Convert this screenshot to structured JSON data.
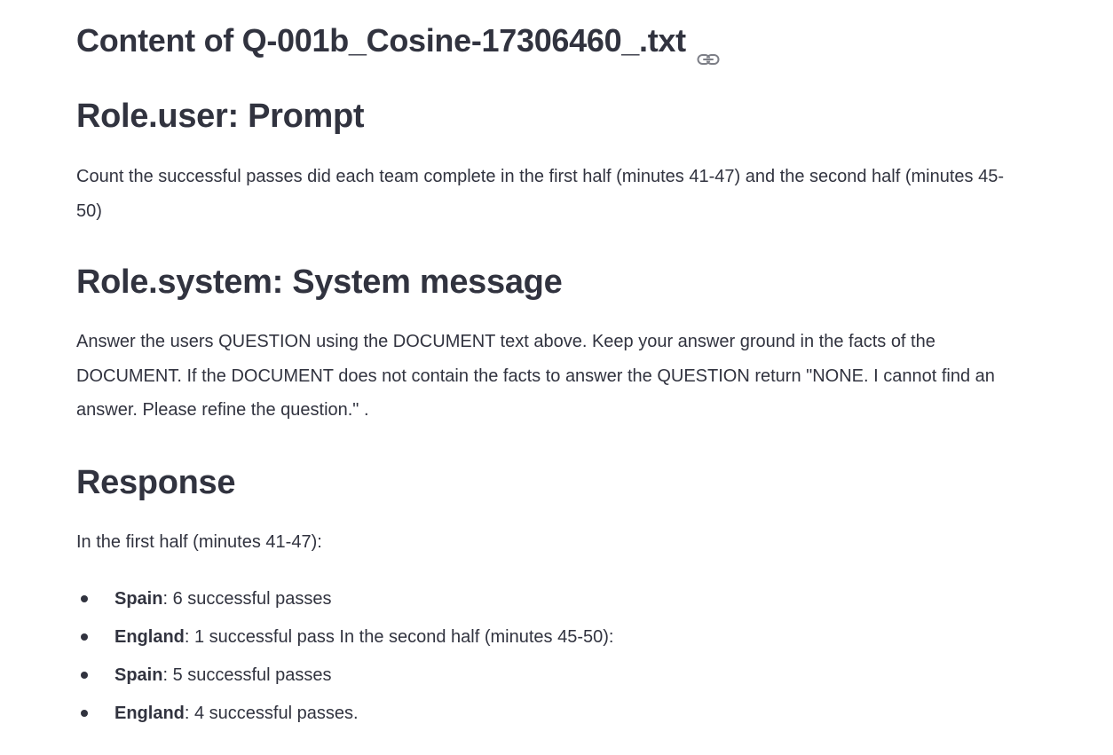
{
  "document": {
    "title": "Content of Q-001b_Cosine-17306460_.txt",
    "title_icon": "link-icon"
  },
  "sections": {
    "prompt": {
      "heading": "Role.user: Prompt",
      "text": "Count the successful passes did each team complete in the first half (minutes 41-47) and the second half (minutes 45-50)"
    },
    "system": {
      "heading": "Role.system: System message",
      "text": "Answer the users QUESTION using the DOCUMENT text above. Keep your answer ground in the facts of the DOCUMENT. If the DOCUMENT does not contain the facts to answer the QUESTION return \"NONE. I cannot find an answer. Please refine the question.\" ."
    },
    "response": {
      "heading": "Response",
      "intro": "In the first half (minutes 41-47):",
      "items": [
        {
          "team": "Spain",
          "detail": ": 6 successful passes"
        },
        {
          "team": "England",
          "detail": ": 1 successful pass In the second half (minutes 45-50):"
        },
        {
          "team": "Spain",
          "detail": ": 5 successful passes"
        },
        {
          "team": "England",
          "detail": ": 4 successful passes."
        }
      ]
    }
  },
  "colors": {
    "text": "#31333f",
    "background": "#ffffff",
    "icon": "#7d7f87"
  }
}
